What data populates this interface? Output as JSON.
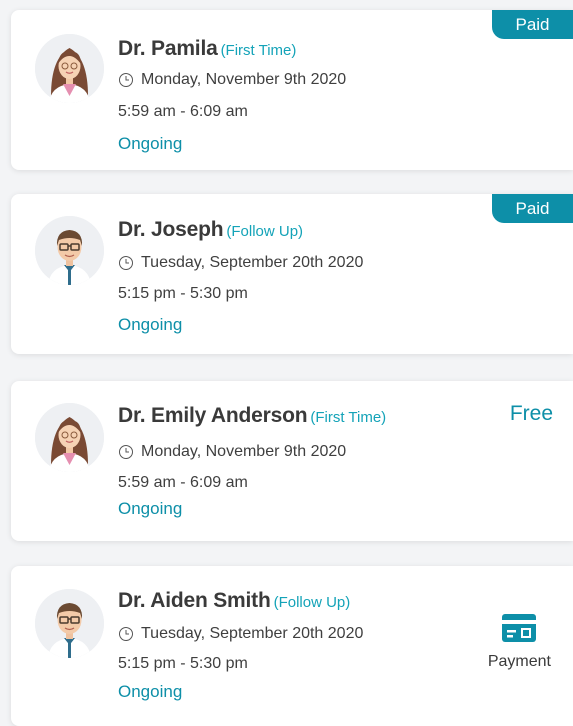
{
  "colors": {
    "accent": "#0d8fa8",
    "visit_type": "#14a3b8",
    "name": "#3a3a3a"
  },
  "appointments": [
    {
      "doctor": "Dr. Pamila",
      "visit_type": "(First Time)",
      "date": "Monday, November 9th 2020",
      "time": "5:59 am - 6:09 am",
      "status": "Ongoing",
      "payment_badge": "Paid",
      "avatar_icon": "female-doctor-avatar"
    },
    {
      "doctor": "Dr. Joseph",
      "visit_type": "(Follow Up)",
      "date": "Tuesday, September 20th 2020",
      "time": "5:15 pm - 5:30 pm",
      "status": "Ongoing",
      "payment_badge": "Paid",
      "avatar_icon": "male-doctor-avatar"
    },
    {
      "doctor": "Dr. Emily Anderson",
      "visit_type": "(First Time)",
      "date": "Monday, November 9th 2020",
      "time": "5:59 am - 6:09 am",
      "status": "Ongoing",
      "payment_badge": "Free",
      "avatar_icon": "female-doctor-avatar"
    },
    {
      "doctor": "Dr. Aiden Smith",
      "visit_type": "(Follow Up)",
      "date": "Tuesday, September 20th 2020",
      "time": "5:15 pm - 5:30 pm",
      "status": "Ongoing",
      "payment_action": "Payment",
      "payment_icon": "credit-card-icon",
      "avatar_icon": "male-doctor-avatar"
    }
  ]
}
